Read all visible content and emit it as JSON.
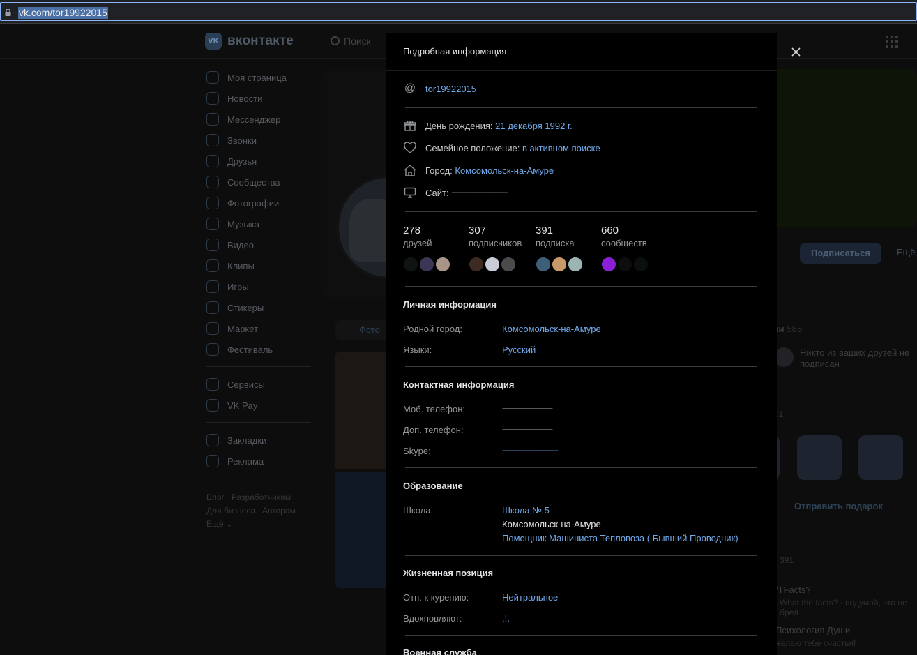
{
  "browser": {
    "url": "vk.com/tor19922015"
  },
  "bg": {
    "logo_text": "вконтакте",
    "search_placeholder": "Поиск",
    "nav": [
      "Моя страница",
      "Новости",
      "Мессенджер",
      "Звонки",
      "Друзья",
      "Сообщества",
      "Фотографии",
      "Музыка",
      "Видео",
      "Клипы",
      "Игры",
      "Стикеры",
      "Маркет",
      "Фестиваль"
    ],
    "nav2": [
      "Сервисы",
      "VK Pay"
    ],
    "nav3": [
      "Закладки",
      "Реклама"
    ],
    "footer": {
      "l1a": "Блог",
      "l1b": "Разработчикам",
      "l2a": "Для бизнеса",
      "l2b": "Авторам",
      "l3": "Ещё ⌄"
    },
    "subscribe": "Подписаться",
    "more": "Ещё",
    "photo_tab": "Фото",
    "right_title": "ки",
    "right_title_count": "585",
    "right_note": "Никто из ваших друзей не подписан",
    "gifts_count": "51",
    "send_gift": "Отправить подарок",
    "subs_count": "391",
    "group1": "/TFacts?",
    "group1_sub": "What the facts? - подумай, это не бред",
    "group2": "Психология Души",
    "group2_sub": "желаю тебе счастья!"
  },
  "modal": {
    "title": "Подробная информация",
    "username": "tor19922015",
    "birthday_label": "День рождения:",
    "birthday": "21 декабря 1992 г.",
    "family_label": "Семейное положение:",
    "family": "в активном поиске",
    "city_label": "Город:",
    "city": "Комсомольск-на-Амуре",
    "site_label": "Сайт:",
    "site": "------------------------------",
    "stats": [
      {
        "value": "278",
        "label": "друзей"
      },
      {
        "value": "307",
        "label": "подписчиков"
      },
      {
        "value": "391",
        "label": "подписка"
      },
      {
        "value": "660",
        "label": "сообществ"
      }
    ],
    "personal": {
      "title": "Личная информация",
      "hometown_label": "Родной город:",
      "hometown": "Комсомольск-на-Амуре",
      "languages_label": "Языки:",
      "languages": "Русский"
    },
    "contact": {
      "title": "Контактная информация",
      "mobile_label": "Моб. телефон:",
      "mobile": "---------------------------",
      "phone2_label": "Доп. телефон:",
      "phone2": "---------------------------",
      "skype_label": "Skype:",
      "skype": "------------------------------"
    },
    "education": {
      "title": "Образование",
      "school_label": "Школа:",
      "school": "Школа № 5",
      "school_city": "Комсомольск-на-Амуре",
      "school_spec": "Помощник Машиниста Тепловоза ( Бывший Проводник)"
    },
    "life": {
      "title": "Жизненная позиция",
      "smoking_label": "Отн. к курению:",
      "smoking": "Нейтральное",
      "inspire_label": "Вдохновляют:",
      "inspire": ".!."
    },
    "military_title": "Военная служба"
  }
}
